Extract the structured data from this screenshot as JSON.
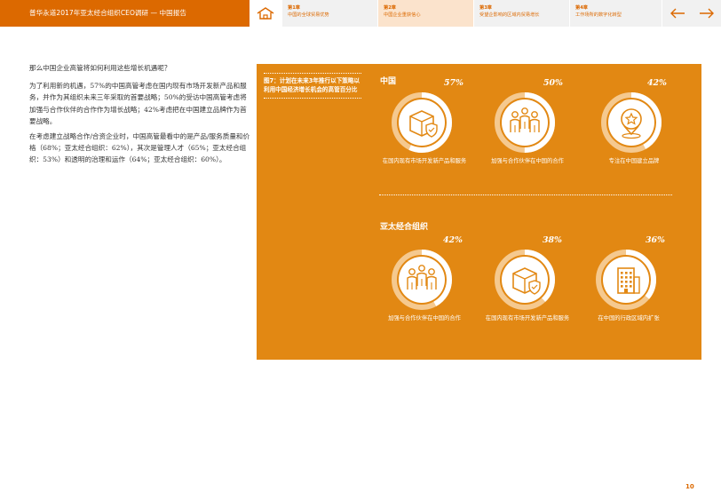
{
  "header": {
    "brand": "普华永道2017年亚太经合组织CEO调研 — 中国报告",
    "chapters": [
      {
        "num": "第1章",
        "title": "中国的全球贸易优势"
      },
      {
        "num": "第2章",
        "title": "中国企业重获信心"
      },
      {
        "num": "第3章",
        "title": "受望企影响的区域内贸易增长"
      },
      {
        "num": "第4章",
        "title": "工作场所的数字化转型"
      }
    ]
  },
  "body": {
    "question": "那么中国企业高管将如何利用这些增长机遇呢？",
    "para1": "为了利用新的机遇，57%的中国高管考虑在国内现有市场开发新产品和服务，并作为其组织未来三年采取的首要战略；50%的受访中国高管考虑将加强与合作伙伴的合作作为增长战略；42%考虑把在中国建立品牌作为首要战略。",
    "para2": "在考虑建立战略合作/合资企业时，中国高管最看中的是产品/服务质量和价格（68%；亚太经合组织：62%），其次是管理人才（65%；亚太经合组织：53%）和透明的治理和运作（64%；亚太经合组织：60%）。"
  },
  "figure": {
    "title": "图7：计划在未来3年推行以下策略以利用中国经济增长机会的高管百分比",
    "sections": [
      {
        "title": "中国",
        "items": [
          {
            "pct": "57%",
            "value": 57,
            "label": "在国内现有市场开发新产品和服务",
            "icon": "box-shield-icon"
          },
          {
            "pct": "50%",
            "value": 50,
            "label": "加强与合作伙伴在中国的合作",
            "icon": "people-group-icon"
          },
          {
            "pct": "42%",
            "value": 42,
            "label": "专注在中国建立品牌",
            "icon": "location-star-icon"
          }
        ]
      },
      {
        "title": "亚太经合组织",
        "items": [
          {
            "pct": "42%",
            "value": 42,
            "label": "加强与合作伙伴在中国的合作",
            "icon": "people-group-icon"
          },
          {
            "pct": "38%",
            "value": 38,
            "label": "在国内现有市场开发新产品和服务",
            "icon": "box-shield-icon"
          },
          {
            "pct": "36%",
            "value": 36,
            "label": "在中国的行政区域内扩张",
            "icon": "building-icon"
          }
        ]
      }
    ]
  },
  "page_number": "10",
  "colors": {
    "brand_orange": "#dc6900",
    "panel_orange": "#e28813",
    "ring_track": "#f5c98f"
  }
}
